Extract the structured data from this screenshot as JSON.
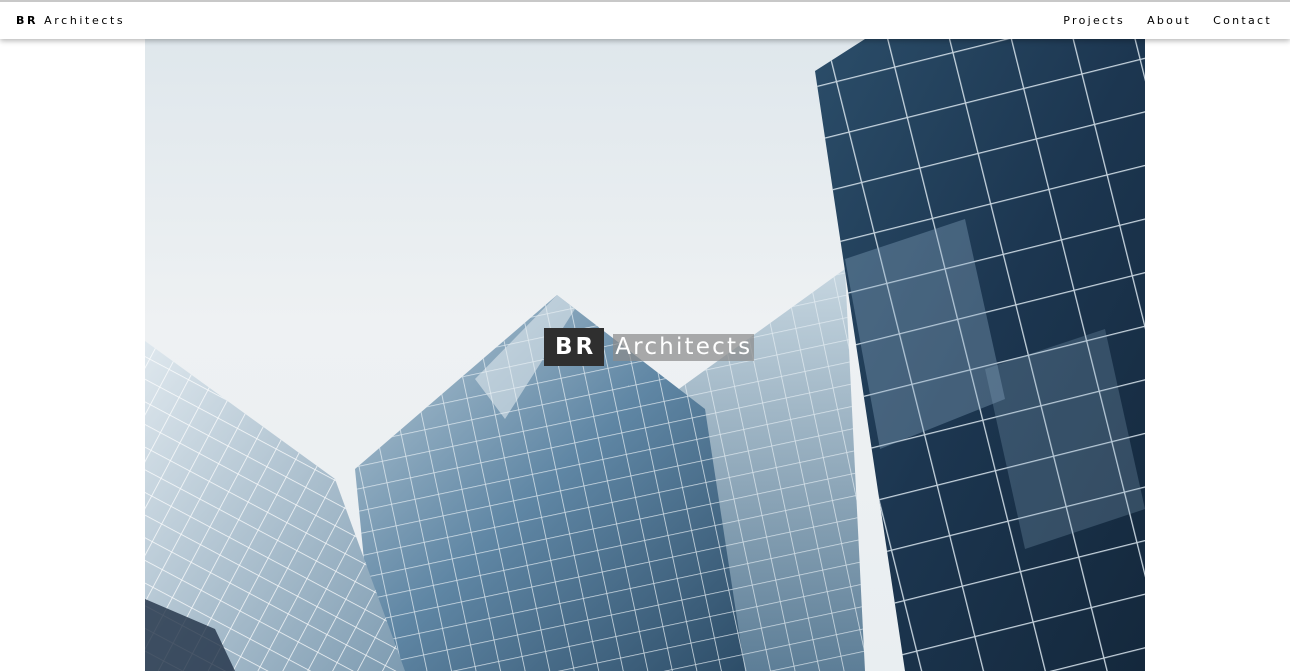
{
  "header": {
    "brand_initials": "BR",
    "brand_name": "Architects",
    "nav": [
      {
        "label": "Projects"
      },
      {
        "label": "About"
      },
      {
        "label": "Contact"
      }
    ]
  },
  "hero": {
    "title_initials": "BR",
    "title_name": "Architects",
    "image_subject": "glass-office-towers-photo"
  },
  "colors": {
    "header_bg": "#ffffff",
    "title_badge": "#2f2f2f",
    "glass_dark": "#1f3a52",
    "glass_light": "#8fb0c8"
  }
}
